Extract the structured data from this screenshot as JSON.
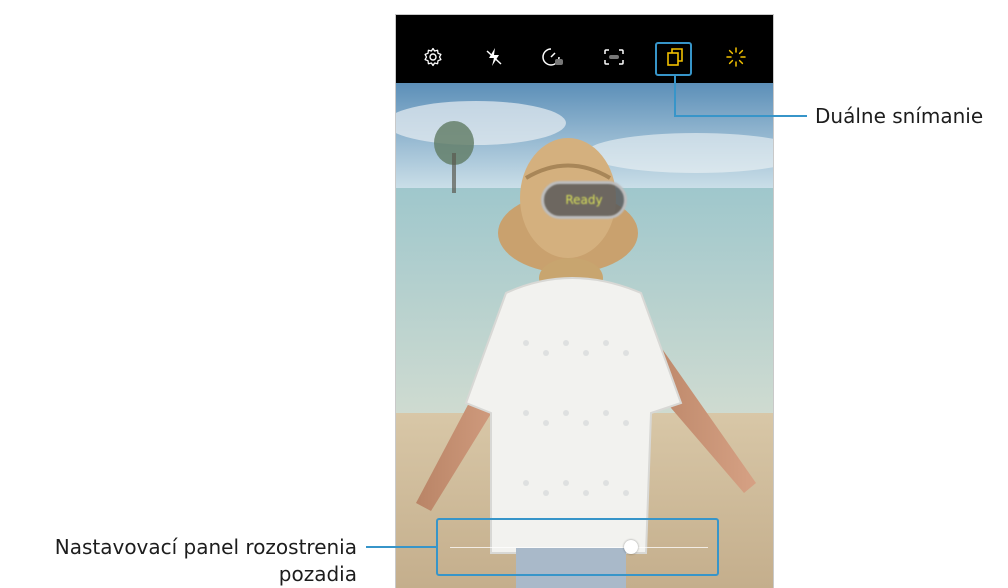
{
  "toolbar": {
    "icons": [
      "settings-icon",
      "flash-off-icon",
      "timer-icon",
      "aspect-ratio-icon",
      "dual-capture-icon",
      "filters-icon"
    ]
  },
  "viewfinder": {
    "status_pill": "Ready",
    "blur_slider_value": 0.7
  },
  "callouts": {
    "dual_capture": "Duálne snímanie",
    "blur_panel_line1": "Nastavovací panel rozostrenia",
    "blur_panel_line2": "pozadia"
  },
  "colors": {
    "accent": "#3795c9",
    "toolbar_bg": "#000000",
    "active_icon": "#f2c100"
  }
}
